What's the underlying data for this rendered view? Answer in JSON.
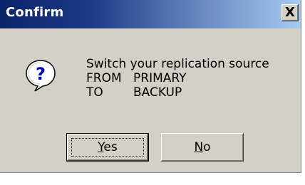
{
  "window": {
    "title": "Confirm",
    "close_glyph": "X"
  },
  "icon": {
    "name": "question-icon",
    "glyph": "?",
    "color": "#0000c0"
  },
  "message": {
    "line1": "Switch your replication source",
    "from_label": "FROM",
    "from_value": "PRIMARY",
    "to_label": "TO",
    "to_value": "BACKUP"
  },
  "buttons": {
    "yes_accel": "Y",
    "yes_rest": "es",
    "no_accel": "N",
    "no_rest": "o"
  },
  "colors": {
    "face": "#d4d0c8",
    "titlebar_start": "#0a246a",
    "titlebar_end": "#a6caf0"
  }
}
